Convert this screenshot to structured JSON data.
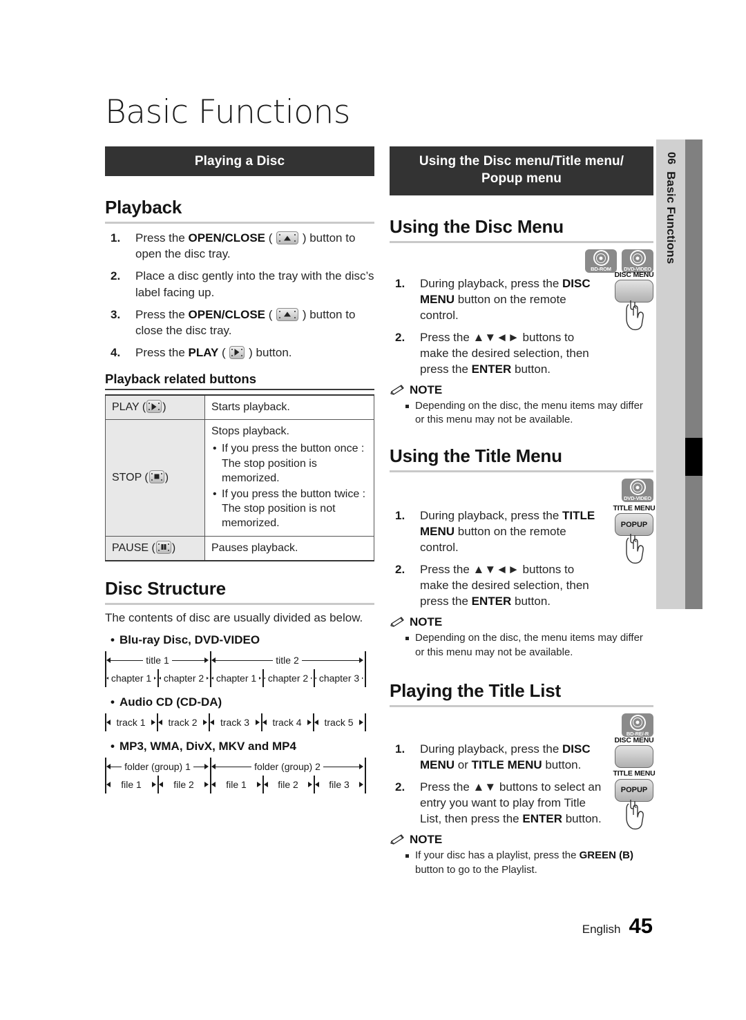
{
  "page": {
    "title": "Basic Functions",
    "chapter_number": "06",
    "chapter_name": "Basic Functions",
    "footer_language": "English",
    "footer_page": "45"
  },
  "left_column": {
    "banner": "Playing a Disc",
    "playback": {
      "heading": "Playback",
      "steps": [
        {
          "num": "1.",
          "pre": "Press the ",
          "bold": "OPEN/CLOSE",
          "mid": " ( ",
          "icon": "eject-key",
          "post": " ) button to open the disc tray."
        },
        {
          "num": "2.",
          "pre": "Place a disc gently into the tray with the disc’s label facing up.",
          "bold": "",
          "mid": "",
          "icon": "",
          "post": ""
        },
        {
          "num": "3.",
          "pre": "Press the ",
          "bold": "OPEN/CLOSE",
          "mid": " ( ",
          "icon": "eject-key",
          "post": " ) button to close the disc tray."
        },
        {
          "num": "4.",
          "pre": "Press the ",
          "bold": "PLAY",
          "mid": " ( ",
          "icon": "play-key",
          "post": " ) button."
        }
      ]
    },
    "playback_buttons": {
      "heading": "Playback related buttons",
      "rows": [
        {
          "label": "PLAY",
          "icon": "play-key",
          "desc": "Starts playback.",
          "bullets": []
        },
        {
          "label": "STOP",
          "icon": "stop-key",
          "desc": "Stops playback.",
          "bullets": [
            "If you press the button once : The stop position is memorized.",
            "If you press the button twice : The stop position is not memorized."
          ]
        },
        {
          "label": "PAUSE",
          "icon": "pause-key",
          "desc": "Pauses playback.",
          "bullets": []
        }
      ]
    },
    "disc_structure": {
      "heading": "Disc Structure",
      "intro": "The contents of disc are usually divided as below.",
      "groups": [
        {
          "label": "Blu-ray Disc, DVD-VIDEO",
          "top_row": [
            "title 1",
            "title 2"
          ],
          "bottom_row": [
            "chapter 1",
            "chapter 2",
            "chapter 1",
            "chapter 2",
            "chapter 3"
          ]
        },
        {
          "label": "Audio CD (CD-DA)",
          "top_row": [],
          "bottom_row": [
            "track 1",
            "track 2",
            "track 3",
            "track 4",
            "track 5"
          ]
        },
        {
          "label": "MP3, WMA, DivX, MKV and MP4",
          "top_row": [
            "folder (group) 1",
            "folder (group) 2"
          ],
          "bottom_row": [
            "file 1",
            "file 2",
            "file 1",
            "file 2",
            "file 3"
          ]
        }
      ]
    }
  },
  "right_column": {
    "banner_line1": "Using the Disc menu/Title menu/",
    "banner_line2": "Popup menu",
    "disc_menu": {
      "heading": "Using the Disc Menu",
      "badges": [
        "BD-ROM",
        "DVD-VIDEO"
      ],
      "remote_keys": [
        {
          "label": "DISC MENU",
          "sub": ""
        }
      ],
      "steps": [
        {
          "num": "1.",
          "pre": "During playback, press the ",
          "bold": "DISC MENU",
          "post": " button on the remote control."
        },
        {
          "num": "2.",
          "pre": "Press the ▲▼◄► buttons to make the desired selection, then press the ",
          "bold": "ENTER",
          "post": " button."
        }
      ],
      "note_title": "NOTE",
      "notes": [
        "Depending on the disc, the menu items may differ or this menu may not be available."
      ]
    },
    "title_menu": {
      "heading": "Using the Title Menu",
      "badges": [
        "DVD-VIDEO"
      ],
      "remote_keys": [
        {
          "label": "TITLE MENU",
          "sub": "POPUP"
        }
      ],
      "steps": [
        {
          "num": "1.",
          "pre": "During playback, press the ",
          "bold": "TITLE MENU",
          "post": " button on the remote control."
        },
        {
          "num": "2.",
          "pre": "Press the ▲▼◄► buttons to make the desired selection, then press the ",
          "bold": "ENTER",
          "post": " button."
        }
      ],
      "note_title": "NOTE",
      "notes": [
        "Depending on the disc, the menu items may differ or this menu may not be available."
      ]
    },
    "title_list": {
      "heading": "Playing the Title List",
      "badges": [
        "BD-RE/-R"
      ],
      "remote_keys": [
        {
          "label": "DISC MENU",
          "sub": ""
        },
        {
          "label": "TITLE MENU",
          "sub": "POPUP"
        }
      ],
      "steps": [
        {
          "num": "1.",
          "pre": "During playback, press the ",
          "bold": "DISC MENU",
          "mid": " or ",
          "bold2": "TITLE MENU",
          "post": " button."
        },
        {
          "num": "2.",
          "pre": "Press the ▲▼ buttons to select an entry you want to play from Title List, then press the ",
          "bold": "ENTER",
          "post": " button."
        }
      ],
      "note_title": "NOTE",
      "notes_rich": [
        {
          "pre": "If your disc has a playlist, press the ",
          "bold": "GREEN (B)",
          "post": " button to go to the Playlist."
        }
      ]
    }
  },
  "colors": {
    "banner_bg": "#333333",
    "tab_bg": "#d0d0d0",
    "tab_bar": "#808080",
    "badge_bg": "#8a8a8a",
    "table_label_bg": "#e8e8e8"
  }
}
